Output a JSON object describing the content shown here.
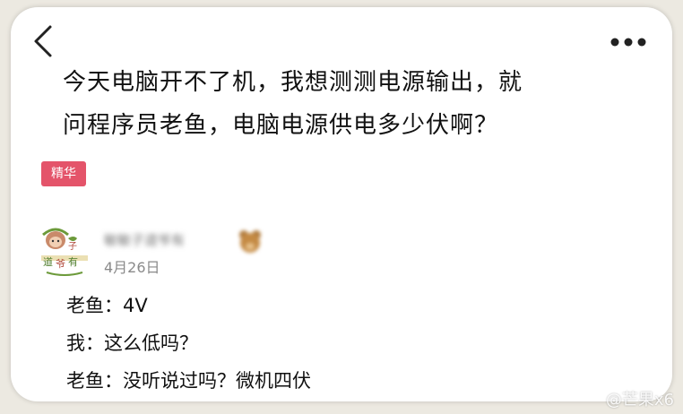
{
  "post": {
    "title_lines": [
      "今天电脑开不了机，我想测测电源输出，就",
      "问程序员老鱼，电脑电源供电多少伏啊？"
    ],
    "badge": "精华"
  },
  "comment": {
    "username": "敏敏子道爷有",
    "date": "4月26日",
    "lines": [
      "老鱼：4V",
      "我：这么低吗？",
      "老鱼：没听说过吗？微机四伏"
    ]
  },
  "watermark": "@芒果x6",
  "colors": {
    "badge": "#e4546a",
    "page_bg": "#ece9e1",
    "card_bg": "#ffffff"
  },
  "icons": {
    "back": "back-chevron-icon",
    "more": "more-dots-icon",
    "avatar": "cartoon-avatar",
    "emoji": "bear-emoji-icon"
  }
}
